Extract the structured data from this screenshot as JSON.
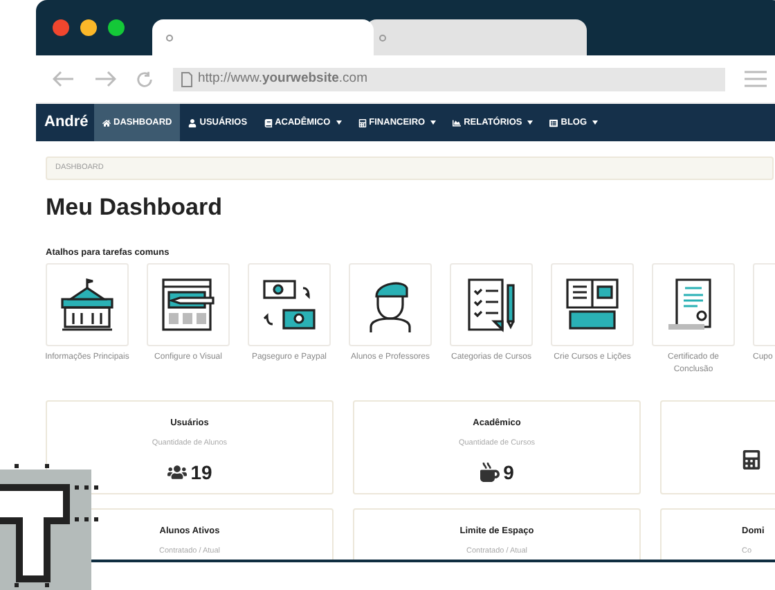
{
  "browser": {
    "tabs": [
      {
        "selected": true
      },
      {
        "selected": false
      }
    ],
    "url": "http://www.**yourwebsite**.com"
  },
  "navbar": {
    "brand": "André",
    "items": [
      {
        "label": "DASHBOARD",
        "kind": "home",
        "dropdown": false,
        "selected": true
      },
      {
        "label": "USUÁRIOS",
        "kind": "user",
        "dropdown": false,
        "selected": false
      },
      {
        "label": "ACADÊMICO",
        "kind": "book",
        "dropdown": true,
        "selected": false
      },
      {
        "label": "FINANCEIRO",
        "kind": "calc",
        "dropdown": true,
        "selected": false
      },
      {
        "label": "RELATÓRIOS",
        "kind": "chart",
        "dropdown": true,
        "selected": false
      },
      {
        "label": "BLOG",
        "kind": "list",
        "dropdown": true,
        "selected": false
      }
    ]
  },
  "breadcrumb": "DASHBOARD",
  "title": "Meu Dashboard",
  "shortcuts_label": "Atalhos para tarefas comuns",
  "shortcuts": [
    {
      "kind": "building",
      "label": "Informações Principais"
    },
    {
      "kind": "design",
      "label": "Configure o Visual"
    },
    {
      "kind": "payment",
      "label": "Pagseguro e Paypal"
    },
    {
      "kind": "person",
      "label": "Alunos e Professores"
    },
    {
      "kind": "checklist",
      "label": "Categorias de Cursos"
    },
    {
      "kind": "lesson",
      "label": "Crie Cursos e Lições"
    },
    {
      "kind": "certificate",
      "label": "Certificado de Conclusão"
    },
    {
      "kind": "partial",
      "label": "Cupo"
    }
  ],
  "stats": [
    {
      "title": "Usuários",
      "subtitle": "Quantidade de Alunos",
      "kind": "users",
      "value": "19"
    },
    {
      "title": "Acadêmico",
      "subtitle": "Quantidade de Cursos",
      "kind": "coffee",
      "value": "9"
    },
    {
      "kind": "calculator"
    },
    {
      "title": "Alunos Ativos",
      "subtitle": "Contratado / Atual"
    },
    {
      "title": "Limite de Espaço",
      "subtitle": "Contratado / Atual"
    },
    {
      "title": "Domi",
      "subtitle": "Co"
    }
  ]
}
